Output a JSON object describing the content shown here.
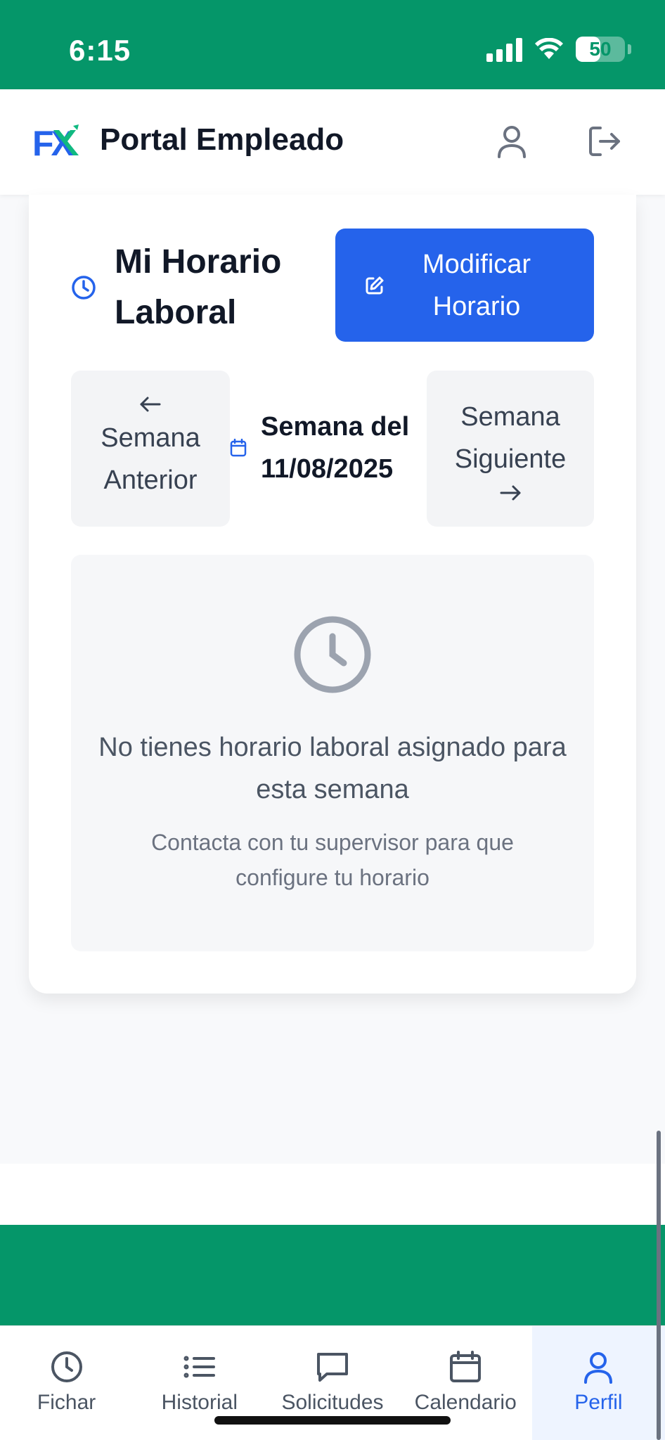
{
  "status": {
    "time": "6:15",
    "battery": "50",
    "battery_level": 0.5
  },
  "header": {
    "title": "Portal Empleado",
    "logo_text": "FX"
  },
  "card": {
    "title": "Mi Horario Laboral",
    "modify_label": "Modificar Horario",
    "prev_label": "Semana Anterior",
    "next_label": "Semana Siguiente",
    "week_label": "Semana del 11/08/2025"
  },
  "empty_state": {
    "title": "No tienes horario laboral asignado para esta semana",
    "subtitle": "Contacta con tu supervisor para que configure tu horario"
  },
  "tabs": [
    {
      "label": "Fichar",
      "icon": "clock-icon"
    },
    {
      "label": "Historial",
      "icon": "list-icon"
    },
    {
      "label": "Solicitudes",
      "icon": "message-icon"
    },
    {
      "label": "Calendario",
      "icon": "calendar-icon"
    },
    {
      "label": "Perfil",
      "icon": "user-icon",
      "active": true
    }
  ],
  "colors": {
    "primary": "#2563eb",
    "brand_green": "#059669"
  }
}
